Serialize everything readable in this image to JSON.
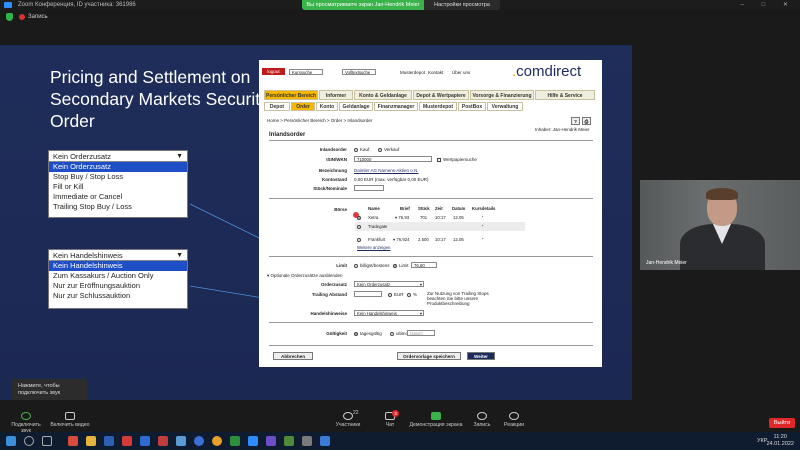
{
  "window": {
    "title": "Zoom Конференция, ID участника: 361986",
    "viewing_banner": "Вы просматриваете экран Jan-Hendrik Meier",
    "view_options": "Настройки просмотра",
    "recording": "Запись"
  },
  "slide": {
    "title": "Pricing and Settlement on Secondary Markets Security Order",
    "dropdown_order": {
      "selected": "Kein Orderzusatz",
      "options": [
        "Kein Orderzusatz",
        "Stop Buy / Stop Loss",
        "Fill or Kill",
        "Immediate or Cancel",
        "Trailing Stop Buy / Loss"
      ]
    },
    "dropdown_trade": {
      "selected": "Kein Handelshinweis",
      "options": [
        "Kein Handelshinweis",
        "Zum Kassakurs / Auction Only",
        "Nur zur Eröffnungsauktion",
        "Nur zur Schlussauktion"
      ]
    }
  },
  "web": {
    "logo_text": "comdirect",
    "logout": "logout",
    "search_input": "Kurssuche",
    "wkn_input": "Volltextsuche",
    "links": [
      "Musterdepot",
      "Kontakt",
      "Über uns"
    ],
    "main_tabs": [
      "Persönlicher Bereich",
      "Informer",
      "Konto & Geldanlage",
      "Depot & Wertpapiere",
      "Vorsorge & Finanzierung",
      "Hilfe & Service"
    ],
    "sub_tabs": [
      "Depot",
      "Order",
      "Konto",
      "Geldanlage",
      "Finanzmanager",
      "Musterdepot",
      "PostBox",
      "Verwaltung"
    ],
    "breadcrumb": "Home > Persönlicher Bereich > Order > Inlandsorder",
    "holder": "Inhaber: Jan-Hendrik Meier",
    "section_title": "Inlandsorder",
    "fields": {
      "type_label": "Inlandsorder",
      "buy": "Kauf",
      "sell": "Verkauf",
      "isin_label": "ISIN/WKN",
      "isin_value": "710000",
      "securities_search": "Wertpapiersuche",
      "name_label": "Bezeichnung",
      "name_value": "Daimler AG Namens-Aktien o.N.",
      "account_label": "Kontostand",
      "account_value": "0,00 EUR (max. verfügbar 0,00 EUR)",
      "qty_label": "Stück/Nominale",
      "exchange_label": "Börse"
    },
    "exchange_table": {
      "headers": [
        "Name",
        "Brief",
        "Stück",
        "Zeit",
        "Datum",
        "Kursdetails"
      ],
      "rows": [
        [
          "Xetra",
          "76,93",
          "701",
          "10:17",
          "12.05"
        ],
        [
          "Tradegate",
          "",
          "",
          "",
          ""
        ],
        [
          "Frankfurt",
          "76,924",
          "2.500",
          "10:17",
          "12.05"
        ]
      ],
      "more": "Weitere anzeigen"
    },
    "limit": {
      "label": "Limit",
      "best": "billigst/bestens",
      "limit": "Limit",
      "value": "76,60"
    },
    "options_toggle": "Optionale Orderzusätze ausblenden",
    "order_addition": {
      "label": "Orderzusatz",
      "value": "Kein Orderzusatz"
    },
    "trailing": {
      "label": "Trailing Abstand",
      "eur": "EUR",
      "percent": "%",
      "note": "Zur Nutzung von Trailing Stops beachten Sie bitte unsere Produktbeschreibung"
    },
    "trade_note": {
      "label": "Handelshinweise",
      "value": "Kein Handelshinweis"
    },
    "validity": {
      "label": "Gültigkeit",
      "today": "tagesgültig",
      "until": "ultimo",
      "date": "Datum"
    },
    "buttons": {
      "cancel": "Abbrechen",
      "template": "Ordervorlage speichern",
      "next": "Weiter"
    }
  },
  "participant": {
    "name": "Jan-Hendrik Meier"
  },
  "toast": "Нажмите, чтобы подключить звук",
  "toolbar": {
    "audio": "Подключить звук",
    "video": "Включить видео",
    "participants": "Участники",
    "participants_count": "22",
    "chat": "Чат",
    "chat_badge": "3",
    "share": "Демонстрация экрана",
    "record": "Запись",
    "reactions": "Реакции",
    "leave": "Выйти"
  },
  "taskbar": {
    "time": "11:20",
    "date": "24.01.2022",
    "lang": "УКР"
  },
  "colors": {
    "accent": "#f5b600",
    "slide_bg": "#1f2d5a",
    "selection": "#1e4fc7",
    "zoom_green": "#3ab44a"
  }
}
